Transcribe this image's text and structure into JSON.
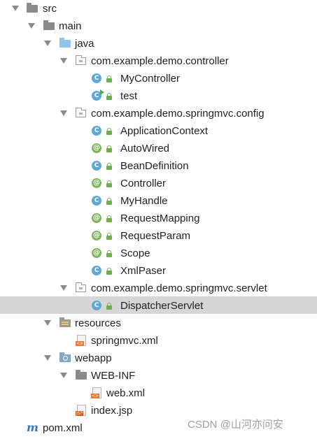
{
  "tree": {
    "src": "src",
    "main": "main",
    "java": "java",
    "pkg_controller": "com.example.demo.controller",
    "my_controller": "MyController",
    "test": "test",
    "pkg_config": "com.example.demo.springmvc.config",
    "application_context": "ApplicationContext",
    "auto_wired": "AutoWired",
    "bean_definition": "BeanDefinition",
    "controller": "Controller",
    "my_handle": "MyHandle",
    "request_mapping": "RequestMapping",
    "request_param": "RequestParam",
    "scope": "Scope",
    "xml_paser": "XmlPaser",
    "pkg_servlet": "com.example.demo.springmvc.servlet",
    "dispatcher_servlet": "DispatcherServlet",
    "resources": "resources",
    "springmvc_xml": "springmvc.xml",
    "webapp": "webapp",
    "web_inf": "WEB-INF",
    "web_xml": "web.xml",
    "index_jsp": "index.jsp",
    "pom_xml": "pom.xml"
  },
  "icons": {
    "class_letter": "C",
    "annotation_letter": "@",
    "maven_letter": "m",
    "xml_tag": "<>",
    "jsp_tag": "JSP"
  },
  "watermark": "CSDN @山河亦问安",
  "colors": {
    "selection": "#d6d6d6",
    "class_icon": "#5fa8d6",
    "annotation_icon": "#7fb55d",
    "source_folder": "#8ec5e8"
  }
}
